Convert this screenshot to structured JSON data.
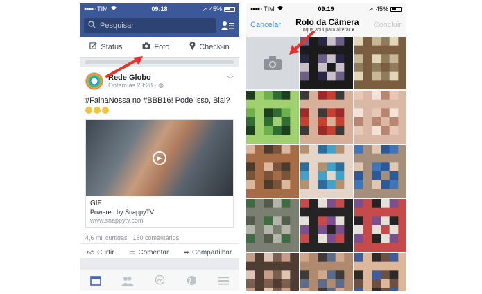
{
  "left": {
    "status": {
      "carrier": "TIM",
      "time": "09:18",
      "battery": "45%"
    },
    "header": {
      "search_placeholder": "Pesquisar"
    },
    "composer": {
      "status": "Status",
      "photo": "Foto",
      "checkin": "Check-in"
    },
    "post": {
      "author": "Rede Globo",
      "time": "Ontem às 23:28 ·",
      "text_prefix": "#FalhaNossa",
      "text_mid": " no ",
      "text_tag": "#BBB16",
      "text_suffix": "! Pode isso, Bial?",
      "media_title": "GIF",
      "media_desc": "Powered by SnappyTV",
      "media_link": "www.snappytv.com",
      "likes": "4,6 mil curtidas",
      "comments": "180 comentários",
      "action_like": "Curtir",
      "action_comment": "Comentar",
      "action_share": "Compartilhar"
    },
    "colors": {
      "brand": "#3b5998",
      "accent": "#e8322b"
    }
  },
  "right": {
    "status": {
      "carrier": "TIM",
      "time": "09:19",
      "battery": "45%"
    },
    "nav": {
      "cancel": "Cancelar",
      "title": "Rolo da Câmera",
      "subtitle": "Toque aqui para alterar",
      "done": "Concluir"
    },
    "photos": [
      {
        "icon": "camera-icon"
      },
      {
        "palette": [
          "#1b1b1b",
          "#6b5f87",
          "#c9c0c8",
          "#282642"
        ]
      },
      {
        "palette": [
          "#c8b796",
          "#7a5e3f",
          "#e3d6b8",
          "#8f7c5b"
        ]
      },
      {
        "palette": [
          "#2f6d35",
          "#6db04d",
          "#a0d070",
          "#1d3f1f"
        ]
      },
      {
        "palette": [
          "#3a3a3a",
          "#c5402f",
          "#9c2a28",
          "#d8b09a"
        ]
      },
      {
        "palette": [
          "#d9b8a6",
          "#e7c8b6",
          "#b78570",
          "#f3e3d7"
        ]
      },
      {
        "palette": [
          "#4e3b2c",
          "#a56c45",
          "#ddb79d",
          "#7a5438"
        ]
      },
      {
        "palette": [
          "#43a1c7",
          "#2d6d9a",
          "#e5d5c8",
          "#b3906f"
        ]
      },
      {
        "palette": [
          "#3f76b8",
          "#2c5a98",
          "#e1c7b0",
          "#a58f7a"
        ]
      },
      {
        "palette": [
          "#7b7f72",
          "#3e6b3f",
          "#b4b4aa",
          "#535c4b"
        ]
      },
      {
        "palette": [
          "#e5e0d8",
          "#242424",
          "#c74a4a",
          "#7b4f8e"
        ]
      },
      {
        "palette": [
          "#e5e0d8",
          "#242424",
          "#c74a4a",
          "#7b4f8e"
        ]
      },
      {
        "palette": [
          "#c69d88",
          "#7a5f50",
          "#e0c4b3",
          "#4f3d33"
        ]
      },
      {
        "palette": [
          "#b08a6f",
          "#d1a88a",
          "#5b6c8a",
          "#3d3a38"
        ]
      },
      {
        "palette": [
          "#2f2a2a",
          "#dcb79a",
          "#3f5c9b",
          "#6f4f3f"
        ]
      }
    ]
  }
}
